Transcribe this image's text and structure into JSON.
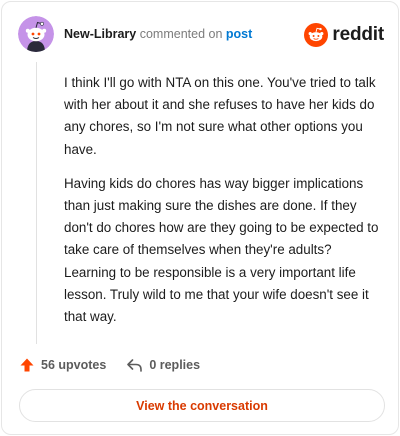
{
  "header": {
    "username": "New-Library",
    "verb": "commented on",
    "post_link": "post",
    "brand": "reddit",
    "avatar_icon": "snoo-avatar-icon",
    "logo_icon": "reddit-logo-icon"
  },
  "comment": {
    "paragraphs": [
      "I think I'll go with NTA on this one. You've tried to talk with her about it and she refuses to have her kids do any chores, so I'm not sure what other options you have.",
      "Having kids do chores has way bigger implications than just making sure the dishes are done. If they don't do chores how are they going to be expected to take care of themselves when they're adults? Learning to be responsible is a very important life lesson. Truly wild to me that your wife doesn't see it that way."
    ]
  },
  "actions": {
    "upvotes": "56 upvotes",
    "replies": "0 replies",
    "upvote_icon": "upvote-arrow-icon",
    "reply_icon": "reply-arrow-icon"
  },
  "footer": {
    "button_label": "View the conversation"
  },
  "colors": {
    "brand_orange": "#ff4500",
    "link_blue": "#0079d3",
    "button_text": "#d93a00",
    "avatar_bg": "#c593e8"
  }
}
